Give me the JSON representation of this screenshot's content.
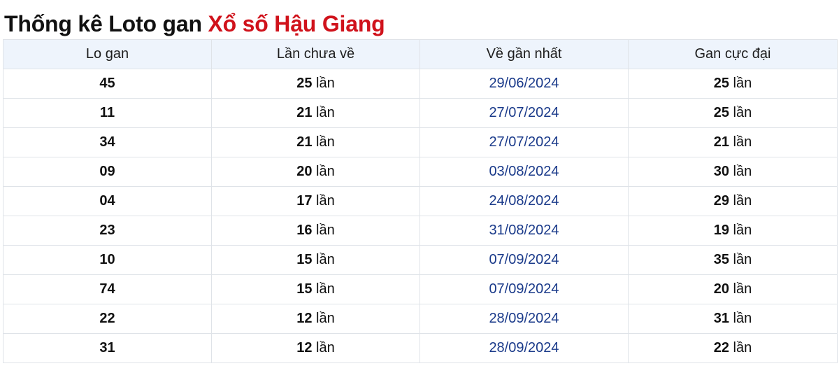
{
  "title": {
    "prefix": "Thống kê Loto gan ",
    "accent": "Xổ số Hậu Giang"
  },
  "colors": {
    "accent": "#d0121b",
    "date": "#1a3a8a",
    "header_bg": "#eef4fc"
  },
  "table": {
    "headers": [
      "Lo gan",
      "Lần chưa về",
      "Về gần nhất",
      "Gan cực đại"
    ],
    "unit": "lần",
    "rows": [
      {
        "lo": "45",
        "chua_ve": "25",
        "gan_nhat": "29/06/2024",
        "cuc_dai": "25"
      },
      {
        "lo": "11",
        "chua_ve": "21",
        "gan_nhat": "27/07/2024",
        "cuc_dai": "25"
      },
      {
        "lo": "34",
        "chua_ve": "21",
        "gan_nhat": "27/07/2024",
        "cuc_dai": "21"
      },
      {
        "lo": "09",
        "chua_ve": "20",
        "gan_nhat": "03/08/2024",
        "cuc_dai": "30"
      },
      {
        "lo": "04",
        "chua_ve": "17",
        "gan_nhat": "24/08/2024",
        "cuc_dai": "29"
      },
      {
        "lo": "23",
        "chua_ve": "16",
        "gan_nhat": "31/08/2024",
        "cuc_dai": "19"
      },
      {
        "lo": "10",
        "chua_ve": "15",
        "gan_nhat": "07/09/2024",
        "cuc_dai": "35"
      },
      {
        "lo": "74",
        "chua_ve": "15",
        "gan_nhat": "07/09/2024",
        "cuc_dai": "20"
      },
      {
        "lo": "22",
        "chua_ve": "12",
        "gan_nhat": "28/09/2024",
        "cuc_dai": "31"
      },
      {
        "lo": "31",
        "chua_ve": "12",
        "gan_nhat": "28/09/2024",
        "cuc_dai": "22"
      }
    ]
  }
}
